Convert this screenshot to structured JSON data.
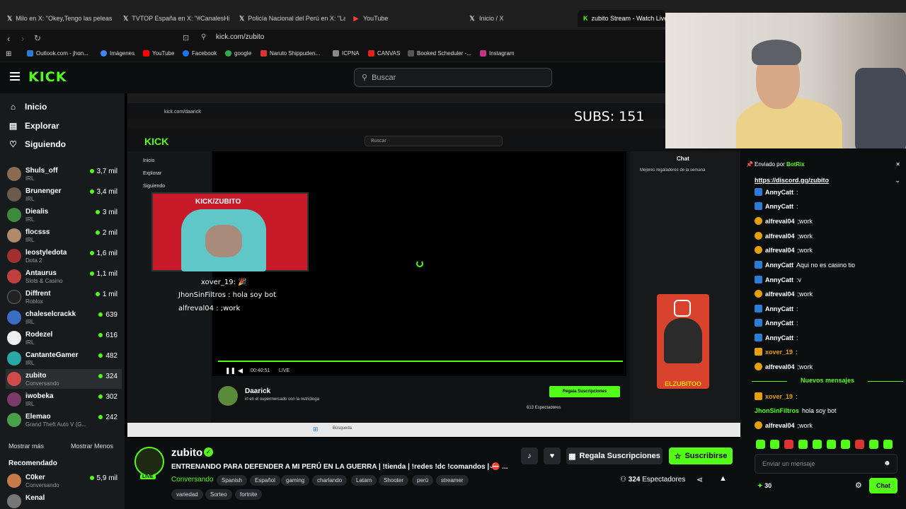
{
  "browser": {
    "tabs": [
      {
        "label": "Milo en X: \"Okey,Tengo las peleas qu",
        "fav": "X",
        "color": "#cfcfcf"
      },
      {
        "label": "TVTOP España en X: \"#CanalesHispa",
        "fav": "X",
        "color": "#cfcfcf"
      },
      {
        "label": "Policía Nacional del Perú en X: \"La",
        "fav": "X",
        "color": "#cfcfcf"
      },
      {
        "label": "YouTube",
        "fav": "▶",
        "color": "#ff3d3d"
      },
      {
        "label": "Inicio / X",
        "fav": "X",
        "color": "#cfcfcf"
      },
      {
        "label": "zubito Stream - Watch Live o",
        "fav": "K",
        "color": "#53fc18"
      }
    ],
    "url": "kick.com/zubito",
    "bookmarks": [
      {
        "label": "Outlook.com - jhon...",
        "color": "#2b7cd3"
      },
      {
        "label": "Imágenes",
        "color": "#4285f4"
      },
      {
        "label": "YouTube",
        "color": "#ff0000"
      },
      {
        "label": "Facebook",
        "color": "#1877f2"
      },
      {
        "label": "google",
        "color": "#34a853"
      },
      {
        "label": "Naruto Shippuden...",
        "color": "#d33"
      },
      {
        "label": "ICPNA",
        "color": "#888"
      },
      {
        "label": "CANVAS",
        "color": "#e2231a"
      },
      {
        "label": "Booked Scheduler -...",
        "color": "#333"
      },
      {
        "label": "Instagram",
        "color": "#c13584"
      }
    ]
  },
  "header": {
    "logo": "KICK",
    "search_placeholder": "Buscar"
  },
  "sidebar": {
    "nav": [
      "Inicio",
      "Explorar",
      "Siguiendo"
    ],
    "channels": [
      {
        "name": "Shuls_off",
        "category": "IRL",
        "viewers": "3,7 mil",
        "color": "#8a6b52"
      },
      {
        "name": "Brunenger",
        "category": "IRL",
        "viewers": "3,4 mil",
        "color": "#6b5b4a"
      },
      {
        "name": "Diealis",
        "category": "IRL",
        "viewers": "3 mil",
        "color": "#3d8b3d"
      },
      {
        "name": "flocsss",
        "category": "IRL",
        "viewers": "2 mil",
        "color": "#b08a6b"
      },
      {
        "name": "leostyledota",
        "category": "Dota 2",
        "viewers": "1,6 mil",
        "color": "#a03030"
      },
      {
        "name": "Antaurus",
        "category": "Slots & Casino",
        "viewers": "1,1 mil",
        "color": "#c04040"
      },
      {
        "name": "Diffrent",
        "category": "Roblox",
        "viewers": "1 mil",
        "color": "#222"
      },
      {
        "name": "chaleselcrackk",
        "category": "IRL",
        "viewers": "639",
        "color": "#3a6ec2"
      },
      {
        "name": "Rodezel",
        "category": "IRL",
        "viewers": "616",
        "color": "#eee"
      },
      {
        "name": "CantanteGamer",
        "category": "IRL",
        "viewers": "482",
        "color": "#2aa8a8"
      },
      {
        "name": "zubito",
        "category": "Conversando",
        "viewers": "324",
        "color": "#d04a4a",
        "active": true
      },
      {
        "name": "iwobeka",
        "category": "IRL",
        "viewers": "302",
        "color": "#7a3a6a"
      },
      {
        "name": "Elemao",
        "category": "Grand Theft Auto V (G...",
        "viewers": "242",
        "color": "#4aa04a"
      }
    ],
    "show_more": "Mostrar más",
    "show_less": "Mostrar Menos",
    "recommended": "Recomendado",
    "recommended_channels": [
      {
        "name": "C0ker",
        "category": "Conversando",
        "viewers": "5,9 mil",
        "color": "#c87b4a"
      },
      {
        "name": "Kenal",
        "category": "",
        "viewers": "",
        "color": "#777"
      }
    ]
  },
  "video": {
    "subs_label": "SUBS: 151",
    "overlay_header": "KICK/ZUBITO",
    "overlay_messages": [
      "xover_19: 🎉",
      "JhonSinFiltros : hola soy bot",
      "alfreval04 : ;work"
    ],
    "instagram_label": "ELZUBITOO",
    "inner": {
      "url": "kick.com/daarick",
      "logo": "KICK",
      "search": "Buscar",
      "nav": [
        "Inicio",
        "Explorar",
        "Siguiendo"
      ],
      "chat_title": "Chat",
      "chat_sub": "Mejores regaladores de la semana",
      "streamer": "Daarick",
      "stream_title": "irl en el supermercado con la nutrióloga",
      "time": "00:40:51",
      "live": "LIVE",
      "subs_button": "Regala Suscripciones",
      "viewers": "613",
      "viewers_label": "Espectadores",
      "search_taskbar": "Búsqueda"
    }
  },
  "stream": {
    "name": "zubito",
    "title": "ENTRENANDO PARA DEFENDER A MI PERÚ EN LA GUERRA | !tienda | !redes !dc !comandos | ⛔ ...",
    "category": "Conversando",
    "tags": [
      "Spanish",
      "Español",
      "gaming",
      "charlando",
      "Latam",
      "Shooter",
      "perú",
      "streamer",
      "variedad",
      "Sorteo",
      "fortnite"
    ],
    "gift_button": "Regala Suscripciones",
    "subscribe_button": "Suscribirse",
    "viewers": "324",
    "viewers_label": "Espectadores"
  },
  "chat": {
    "pinned_prefix": "Enviado por",
    "pinned_user": "BotRix",
    "pinned_link": "https://discord.gg/zubito",
    "messages": [
      {
        "user": "AnnyCatt",
        "text": ":",
        "color": "#fff",
        "badge": "#2b7cd3"
      },
      {
        "user": "AnnyCatt",
        "text": ":",
        "color": "#fff",
        "badge": "#2b7cd3"
      },
      {
        "user": "alfreval04",
        "text": ";work",
        "color": "#fff",
        "badge": "#e6a100"
      },
      {
        "user": "alfreval04",
        "text": ";work",
        "color": "#fff",
        "badge": "#e6a100"
      },
      {
        "user": "alfreval04",
        "text": ";work",
        "color": "#fff",
        "badge": "#e6a100"
      },
      {
        "user": "AnnyCatt",
        "text": "Aqui no es casino tio",
        "color": "#fff",
        "badge": "#2b7cd3"
      },
      {
        "user": "AnnyCatt",
        "text": ":v",
        "color": "#fff",
        "badge": "#2b7cd3"
      },
      {
        "user": "alfreval04",
        "text": ";work",
        "color": "#fff",
        "badge": "#e6a100"
      },
      {
        "user": "AnnyCatt",
        "text": ":",
        "color": "#fff",
        "badge": "#2b7cd3"
      },
      {
        "user": "AnnyCatt",
        "text": ":",
        "color": "#fff",
        "badge": "#2b7cd3"
      },
      {
        "user": "AnnyCatt",
        "text": ":",
        "color": "#fff",
        "badge": "#2b7cd3"
      },
      {
        "user": "xover_19",
        "text": ":",
        "color": "#e6a100",
        "badge": "#e6a100"
      },
      {
        "user": "alfreval04",
        "text": ";work",
        "color": "#fff",
        "badge": "#e6a100"
      }
    ],
    "new_messages": "Nuevos mensajes",
    "new": [
      {
        "user": "xover_19",
        "text": ":",
        "color": "#e6a100",
        "badge": "#e6a100"
      },
      {
        "user": "JhonSinFiltros",
        "text": "hola soy bot",
        "color": "#53fc18",
        "badge": "#53fc18"
      },
      {
        "user": "alfreval04",
        "text": ";work",
        "color": "#fff",
        "badge": "#e6a100"
      }
    ],
    "input_placeholder": "Enviar un mensaje",
    "points": "30",
    "send_button": "Chat"
  }
}
